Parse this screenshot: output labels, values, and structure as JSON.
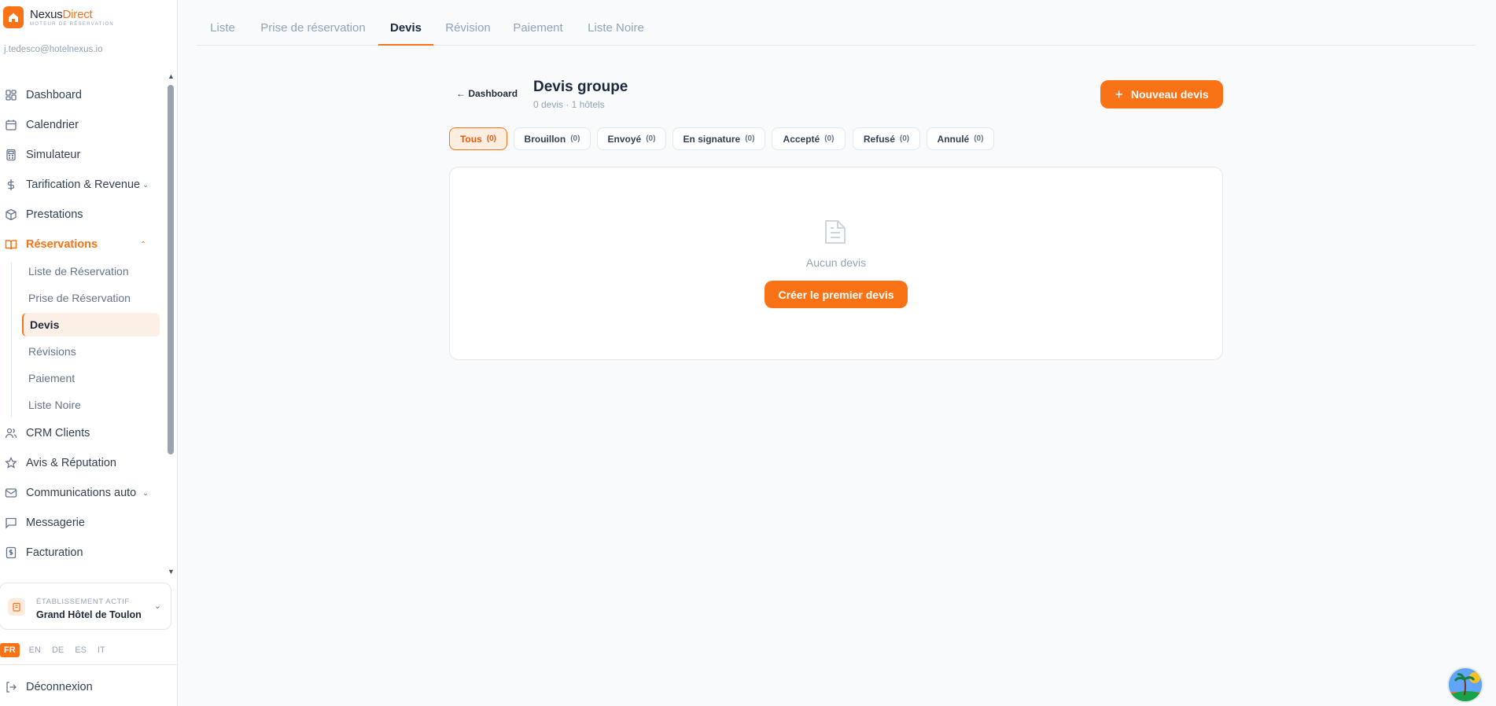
{
  "brand": {
    "name_part1": "Nexus",
    "name_part2": "Direct",
    "tagline": "MOTEUR DE RÉSERVATION"
  },
  "user": {
    "email": "j.tedesco@hotelnexus.io"
  },
  "sidebar": {
    "items": [
      {
        "label": "Dashboard",
        "icon": "dashboard-icon"
      },
      {
        "label": "Calendrier",
        "icon": "calendar-icon"
      },
      {
        "label": "Simulateur",
        "icon": "calculator-icon"
      },
      {
        "label": "Tarification & Revenue",
        "icon": "dollar-icon",
        "expandable": true
      },
      {
        "label": "Prestations",
        "icon": "package-icon"
      },
      {
        "label": "Réservations",
        "icon": "book-icon",
        "expandable": true,
        "expanded": true,
        "active": true
      },
      {
        "label": "CRM Clients",
        "icon": "users-icon"
      },
      {
        "label": "Avis & Réputation",
        "icon": "star-icon"
      },
      {
        "label": "Communications auto",
        "icon": "mail-icon",
        "expandable": true
      },
      {
        "label": "Messagerie",
        "icon": "message-icon"
      },
      {
        "label": "Facturation",
        "icon": "invoice-icon"
      }
    ],
    "sub_items": [
      {
        "label": "Liste de Réservation"
      },
      {
        "label": "Prise de Réservation"
      },
      {
        "label": "Devis",
        "active": true
      },
      {
        "label": "Révisions"
      },
      {
        "label": "Paiement"
      },
      {
        "label": "Liste Noire"
      }
    ]
  },
  "establishment": {
    "label": "ÉTABLISSEMENT ACTIF",
    "name": "Grand Hôtel de Toulon"
  },
  "languages": [
    "FR",
    "EN",
    "DE",
    "ES",
    "IT"
  ],
  "active_language": "FR",
  "logout_label": "Déconnexion",
  "tabs": [
    "Liste",
    "Prise de réservation",
    "Devis",
    "Révision",
    "Paiement",
    "Liste Noire"
  ],
  "active_tab": "Devis",
  "header": {
    "back_label": "Dashboard",
    "title": "Devis groupe",
    "subtitle": "0 devis · 1 hôtels",
    "new_button": "Nouveau devis"
  },
  "filters": [
    {
      "label": "Tous",
      "count": "(0)",
      "active": true
    },
    {
      "label": "Brouillon",
      "count": "(0)"
    },
    {
      "label": "Envoyé",
      "count": "(0)"
    },
    {
      "label": "En signature",
      "count": "(0)"
    },
    {
      "label": "Accepté",
      "count": "(0)"
    },
    {
      "label": "Refusé",
      "count": "(0)"
    },
    {
      "label": "Annulé",
      "count": "(0)"
    }
  ],
  "empty_state": {
    "text": "Aucun devis",
    "button": "Créer le premier devis"
  },
  "colors": {
    "accent": "#f97316",
    "accent_soft": "#fdeee1",
    "text": "#1e293b",
    "muted": "#94a3b8"
  }
}
